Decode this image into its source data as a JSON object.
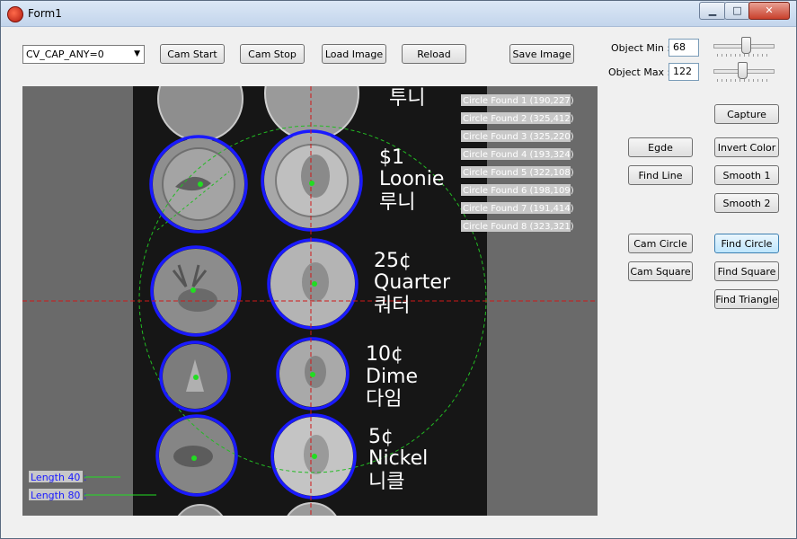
{
  "window": {
    "title": "Form1",
    "controls": {
      "minimize": "▁",
      "maximize": "□",
      "close": "✕"
    }
  },
  "toolbar": {
    "camera_select": "CV_CAP_ANY=0",
    "cam_start": "Cam Start",
    "cam_stop": "Cam Stop",
    "load_image": "Load Image",
    "reload": "Reload",
    "save_image": "Save Image"
  },
  "object": {
    "min_label": "Object Min :",
    "min_value": "68",
    "min_level": 0.54,
    "max_label": "Object Max :",
    "max_value": "122",
    "max_level": 0.48
  },
  "buttons": {
    "capture": "Capture",
    "egde": "Egde",
    "invert_color": "Invert Color",
    "find_line": "Find Line",
    "smooth1": "Smooth 1",
    "smooth2": "Smooth 2",
    "cam_circle": "Cam Circle",
    "find_circle": "Find Circle",
    "cam_square": "Cam Square",
    "find_square": "Find Square",
    "find_triangle": "Find Triangle"
  },
  "overlay": {
    "circles_found": [
      "Circle Found 1 (190,227)",
      "Circle Found 2 (325,412)",
      "Circle Found 3 (325,220)",
      "Circle Found 4 (193,324)",
      "Circle Found 5 (322,108)",
      "Circle Found 6 (198,109)",
      "Circle Found 7 (191,414)",
      "Circle Found 8 (323,321)"
    ],
    "length40": "Length 40 :",
    "length80": "Length 80 :"
  },
  "coin_captions": {
    "top_partial": "투니",
    "loonie": [
      "$1",
      "Loonie",
      "루니"
    ],
    "quarter": [
      "25¢",
      "Quarter",
      "쿼터"
    ],
    "dime": [
      "10¢",
      "Dime",
      "다임"
    ],
    "nickel": [
      "5¢",
      "Nickel",
      "니클"
    ]
  },
  "colors": {
    "detect_circle": "#1a1aff",
    "crosshair": "#d01818",
    "center_dot": "#22dd22",
    "guide_circle": "#22bb22"
  }
}
